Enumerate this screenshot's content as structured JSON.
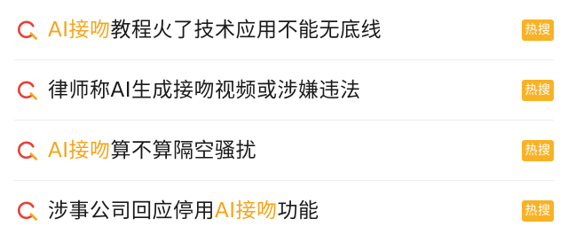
{
  "colors": {
    "highlight": "#f7a417",
    "badge_bg": "#f9b224",
    "text": "#1a1a1a",
    "icon_red": "#e8403a",
    "icon_orange": "#f7a417"
  },
  "items": [
    {
      "icon": "search-icon",
      "pre": "",
      "hl": "AI接吻",
      "post": "教程火了技术应用不能无底线",
      "badge": "热搜"
    },
    {
      "icon": "search-icon",
      "pre": "律师称AI生成接吻视频或涉嫌违法",
      "hl": "",
      "post": "",
      "badge": "热搜"
    },
    {
      "icon": "search-icon",
      "pre": "",
      "hl": "AI接吻",
      "post": "算不算隔空骚扰",
      "badge": "热搜"
    },
    {
      "icon": "search-icon",
      "pre": "涉事公司回应停用",
      "hl": "AI接吻",
      "post": "功能",
      "badge": "热搜"
    }
  ]
}
